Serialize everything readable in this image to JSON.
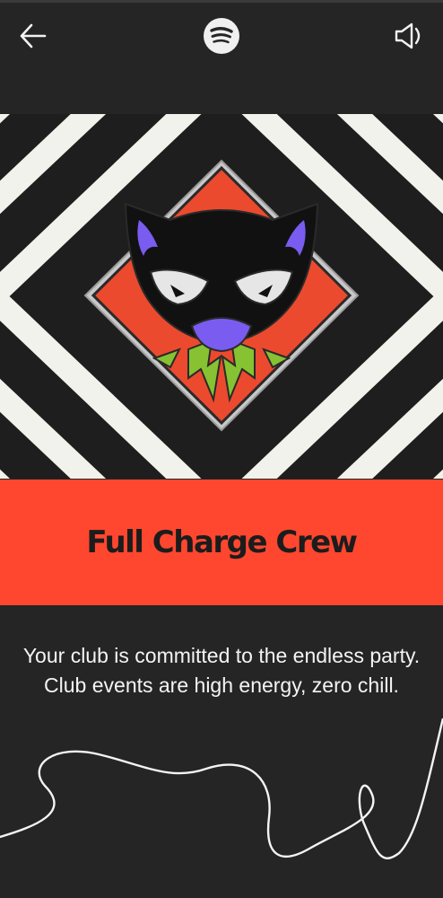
{
  "header": {
    "back_icon": "arrow-left-icon",
    "logo_icon": "spotify-logo-icon",
    "sound_icon": "speaker-icon"
  },
  "badge": {
    "name": "Full Charge Crew",
    "description": "Your club is committed to the endless party. Club events are high energy, zero chill.",
    "illustration": "cat-pin-icon"
  },
  "colors": {
    "background": "#252525",
    "banner": "#ff4730",
    "stripes_light": "#f2f2ec",
    "stripes_dark": "#1e1e1e",
    "pin_red": "#ec4a2e",
    "pin_purple": "#7a5cf0",
    "pin_green": "#86c232"
  }
}
